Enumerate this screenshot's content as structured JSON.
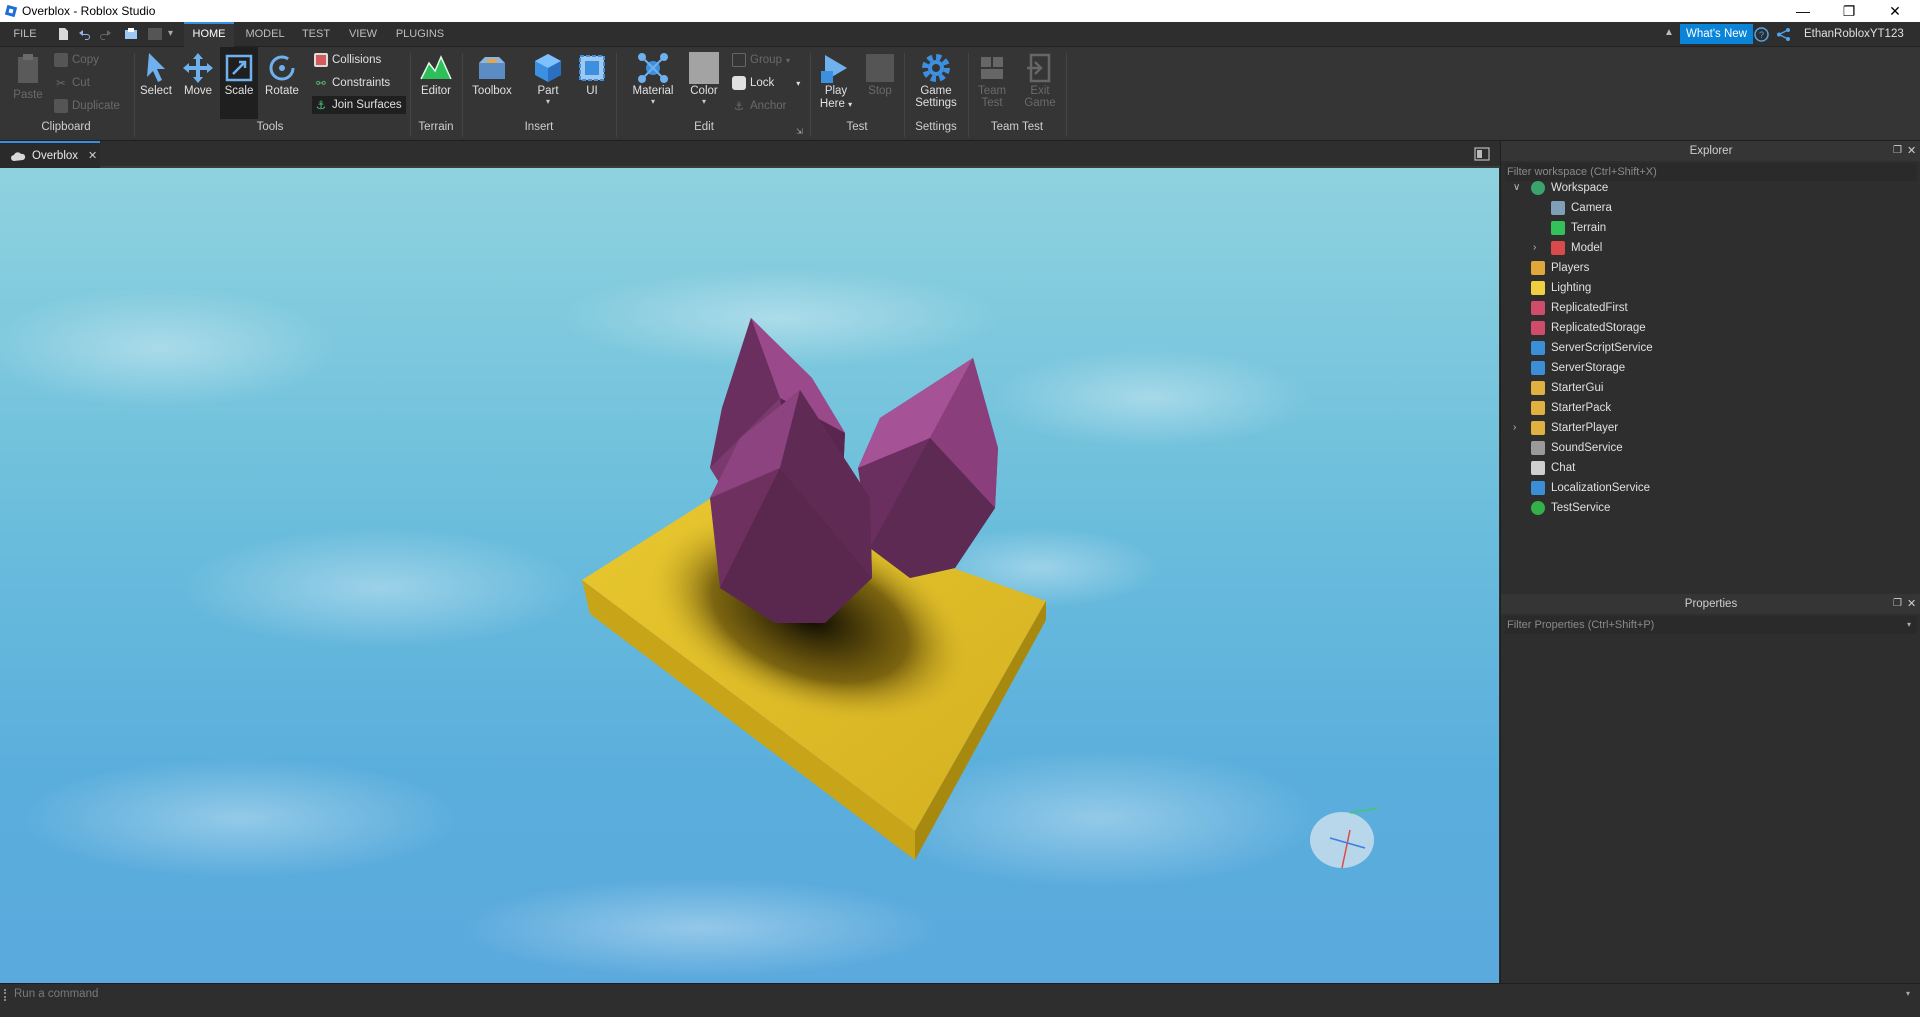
{
  "window": {
    "title": "Overblox - Roblox Studio",
    "controls": [
      "minimize-icon",
      "restore-icon",
      "close-icon"
    ]
  },
  "menubar": {
    "file": "FILE",
    "tabs": [
      "HOME",
      "MODEL",
      "TEST",
      "VIEW",
      "PLUGINS"
    ],
    "active_tab": "HOME",
    "whats_new": "What's New",
    "user": "EthanRobloxYT123"
  },
  "ribbon": {
    "clipboard": {
      "paste": "Paste",
      "copy": "Copy",
      "cut": "Cut",
      "duplicate": "Duplicate",
      "group_label": "Clipboard"
    },
    "tools": {
      "select": "Select",
      "move": "Move",
      "scale": "Scale",
      "rotate": "Rotate",
      "collisions": "Collisions",
      "constraints": "Constraints",
      "join_surfaces": "Join Surfaces",
      "group_label": "Tools"
    },
    "terrain": {
      "editor": "Editor",
      "group_label": "Terrain"
    },
    "insert": {
      "toolbox": "Toolbox",
      "part": "Part",
      "ui": "UI",
      "group_label": "Insert"
    },
    "edit": {
      "material": "Material",
      "color": "Color",
      "group": "Group",
      "lock": "Lock",
      "anchor": "Anchor",
      "group_label": "Edit"
    },
    "test": {
      "play_line1": "Play",
      "play_line2": "Here",
      "stop": "Stop",
      "group_label": "Test"
    },
    "settings": {
      "game_line1": "Game",
      "game_line2": "Settings",
      "group_label": "Settings"
    },
    "team_test": {
      "team_line1": "Team",
      "team_line2": "Test",
      "exit_line1": "Exit",
      "exit_line2": "Game",
      "group_label": "Team Test"
    }
  },
  "document_tab": {
    "label": "Overblox"
  },
  "explorer": {
    "title": "Explorer",
    "filter_placeholder": "Filter workspace (Ctrl+Shift+X)",
    "items": [
      {
        "label": "Workspace",
        "depth": 0,
        "expanded": true,
        "icon": "workspace-icon",
        "color": "#3aa56a"
      },
      {
        "label": "Camera",
        "depth": 1,
        "icon": "camera-icon",
        "color": "#7f9fb8"
      },
      {
        "label": "Terrain",
        "depth": 1,
        "icon": "terrain-icon",
        "color": "#33c25a"
      },
      {
        "label": "Model",
        "depth": 1,
        "collapsed": true,
        "icon": "model-icon",
        "color": "#d94b4b"
      },
      {
        "label": "Players",
        "depth": 0,
        "icon": "players-icon",
        "color": "#e0a83a"
      },
      {
        "label": "Lighting",
        "depth": 0,
        "icon": "lighting-icon",
        "color": "#f0d040"
      },
      {
        "label": "ReplicatedFirst",
        "depth": 0,
        "icon": "replicated-first-icon",
        "color": "#cf4c6a"
      },
      {
        "label": "ReplicatedStorage",
        "depth": 0,
        "icon": "replicated-storage-icon",
        "color": "#cf4c6a"
      },
      {
        "label": "ServerScriptService",
        "depth": 0,
        "icon": "server-script-service-icon",
        "color": "#3a8fd6"
      },
      {
        "label": "ServerStorage",
        "depth": 0,
        "icon": "server-storage-icon",
        "color": "#3a8fd6"
      },
      {
        "label": "StarterGui",
        "depth": 0,
        "icon": "starter-gui-icon",
        "color": "#e0b040"
      },
      {
        "label": "StarterPack",
        "depth": 0,
        "icon": "starter-pack-icon",
        "color": "#e0b040"
      },
      {
        "label": "StarterPlayer",
        "depth": 0,
        "collapsed": true,
        "icon": "starter-player-icon",
        "color": "#e0b040"
      },
      {
        "label": "SoundService",
        "depth": 0,
        "icon": "sound-service-icon",
        "color": "#9a9a9a"
      },
      {
        "label": "Chat",
        "depth": 0,
        "icon": "chat-icon",
        "color": "#d0d0d0"
      },
      {
        "label": "LocalizationService",
        "depth": 0,
        "icon": "localization-service-icon",
        "color": "#3a8fd6"
      },
      {
        "label": "TestService",
        "depth": 0,
        "icon": "test-service-icon",
        "color": "#33b04a"
      }
    ]
  },
  "properties": {
    "title": "Properties",
    "filter_placeholder": "Filter Properties (Ctrl+Shift+P)"
  },
  "command_bar": {
    "placeholder": "Run a command"
  },
  "colors": {
    "accent": "#3b8ddd",
    "whats_new_bg": "#0a84d8",
    "baseplate": "#e2c02c",
    "crystal": "#6a2f5e"
  }
}
